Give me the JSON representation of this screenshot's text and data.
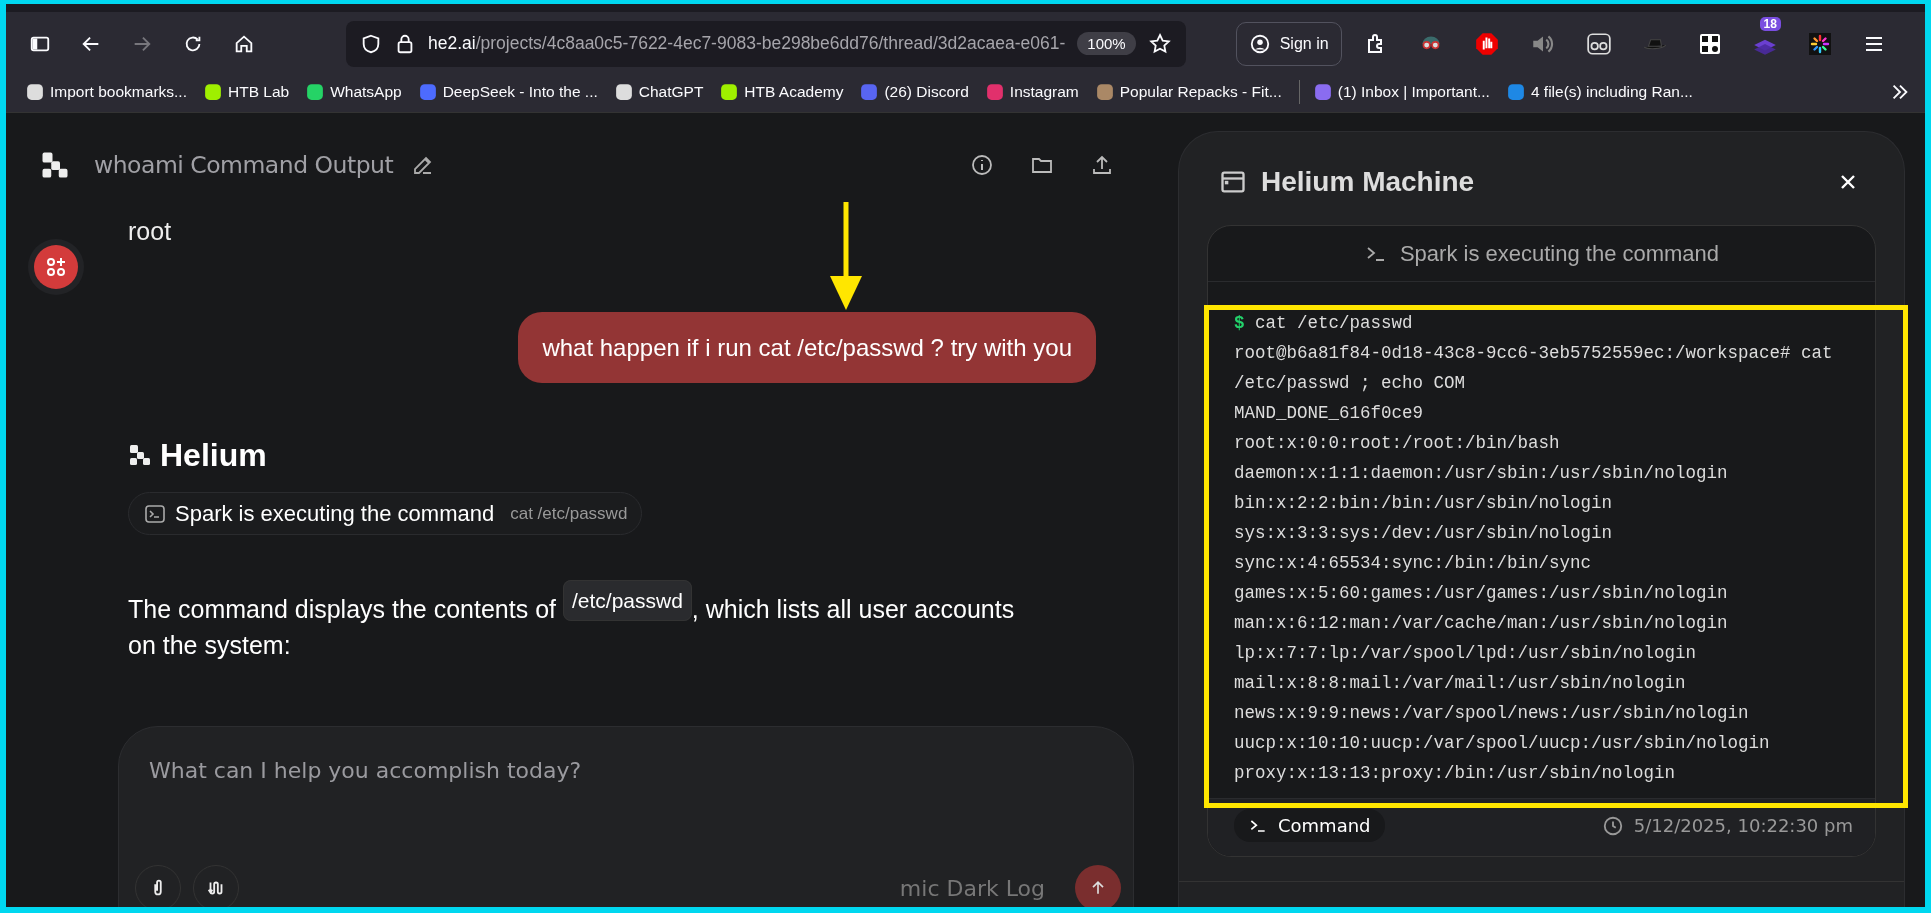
{
  "browser": {
    "url": {
      "host": "he2.ai",
      "path": "/projects/4c8aa0c5-7622-4ec7-9083-be298be6dd76/thread/3d2acaea-e061-"
    },
    "zoom": "100%",
    "sign_in": "Sign in",
    "extension_badge": "18",
    "bookmarks": [
      {
        "label": "Import bookmarks..."
      },
      {
        "label": "HTB Lab"
      },
      {
        "label": "WhatsApp"
      },
      {
        "label": "DeepSeek - Into the ..."
      },
      {
        "label": "ChatGPT"
      },
      {
        "label": "HTB Academy"
      },
      {
        "label": "(26) Discord"
      },
      {
        "label": "Instagram"
      },
      {
        "label": "Popular Repacks - Fit..."
      },
      {
        "label": "(1) Inbox | Important..."
      },
      {
        "label": "4 file(s) including Ran..."
      }
    ]
  },
  "chat": {
    "title": "whoami Command Output",
    "reply_text": "root",
    "user_message": "what happen if i run cat /etc/passwd ? try with you",
    "assistant_name": "Helium",
    "tool_chip": {
      "label": "Spark is executing the command",
      "command": "cat /etc/passwd"
    },
    "paragraph": {
      "before": "The command displays the contents of ",
      "code": "/etc/passwd",
      "after": ", which lists all user accounts on the system:"
    },
    "composer": {
      "placeholder": "What can I help you accomplish today?",
      "overlay_text": "mic Dark Log"
    }
  },
  "panel": {
    "title": "Helium Machine",
    "status": "Spark is executing the command",
    "prompt": "$",
    "command": "cat /etc/passwd",
    "output": [
      "root@b6a81f84-0d18-43c8-9cc6-3eb5752559ec:/workspace# cat /etc/passwd ; echo COM",
      "MAND_DONE_616f0ce9",
      "root:x:0:0:root:/root:/bin/bash",
      "daemon:x:1:1:daemon:/usr/sbin:/usr/sbin/nologin",
      "bin:x:2:2:bin:/bin:/usr/sbin/nologin",
      "sys:x:3:3:sys:/dev:/usr/sbin/nologin",
      "sync:x:4:65534:sync:/bin:/bin/sync",
      "games:x:5:60:games:/usr/games:/usr/sbin/nologin",
      "man:x:6:12:man:/var/cache/man:/usr/sbin/nologin",
      "lp:x:7:7:lp:/var/spool/lpd:/usr/sbin/nologin",
      "mail:x:8:8:mail:/var/mail:/usr/sbin/nologin",
      "news:x:9:9:news:/var/spool/news:/usr/sbin/nologin",
      "uucp:x:10:10:uucp:/var/spool/uucp:/usr/sbin/nologin",
      "proxy:x:13:13:proxy:/bin:/usr/sbin/nologin"
    ],
    "footer_tab": "Command",
    "timestamp": "5/12/2025, 10:22:30 pm"
  }
}
